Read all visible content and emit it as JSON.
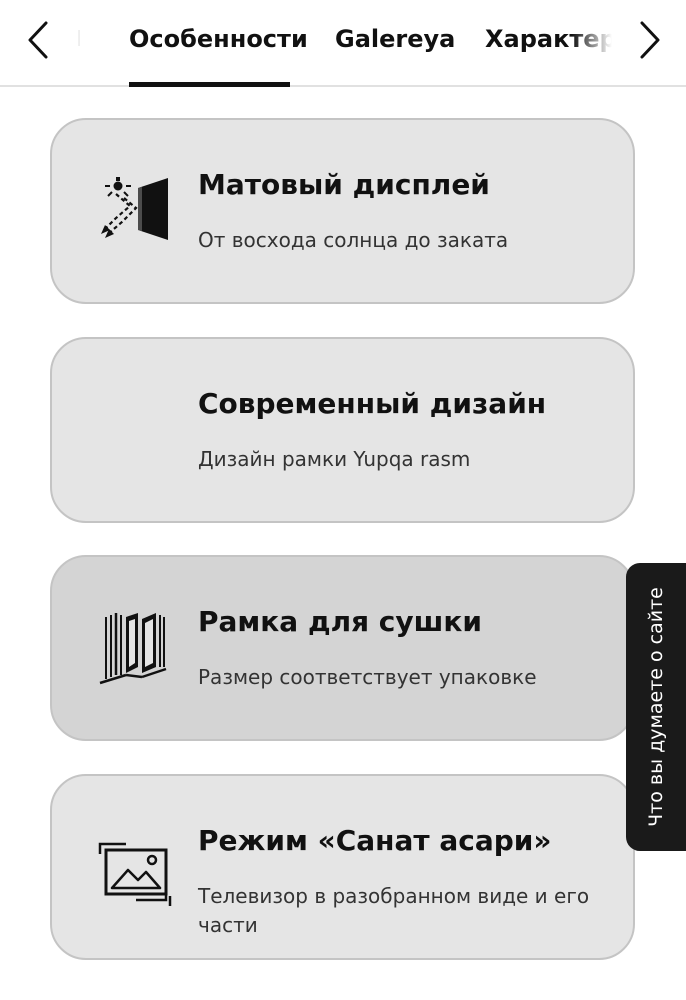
{
  "nav": {
    "prev_icon": "chevron-left-icon",
    "next_icon": "chevron-right-icon"
  },
  "tabs": [
    {
      "label": "Особенности",
      "active": true
    },
    {
      "label": "Galereya",
      "active": false
    },
    {
      "label": "Характеристики",
      "active": false
    }
  ],
  "features": [
    {
      "title": "Матовый дисплей",
      "description": "От восхода солнца до заката",
      "icon": "matte-display-icon"
    },
    {
      "title": "Современный дизайн",
      "description": "Дизайн рамки Yupqa rasm",
      "icon": ""
    },
    {
      "title": "Рамка для сушки",
      "description": "Размер соответствует упаковке",
      "icon": "frame-panels-icon"
    },
    {
      "title": "Режим «Санат асари»",
      "description": "Телевизор в разобранном виде и его части",
      "icon": "art-mode-icon"
    }
  ],
  "feedback": {
    "label": "Что вы думаете о сайте"
  },
  "colors": {
    "card_background": "#e5e5e5",
    "card_active_background": "#d4d4d4",
    "card_border": "#c4c4c4",
    "feedback_background": "#1a1a1a",
    "text": "#111111"
  }
}
